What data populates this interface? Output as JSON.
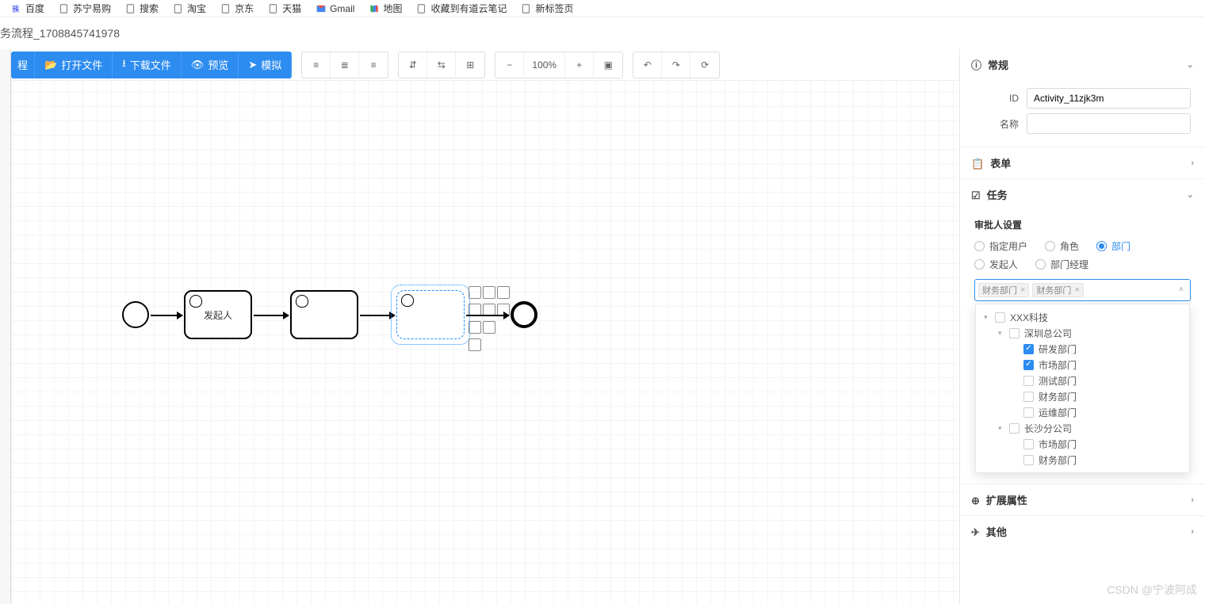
{
  "bookmarks": [
    {
      "label": "百度",
      "icon": "baidu"
    },
    {
      "label": "苏宁易购",
      "icon": "page"
    },
    {
      "label": "搜索",
      "icon": "page"
    },
    {
      "label": "淘宝",
      "icon": "page"
    },
    {
      "label": "京东",
      "icon": "page"
    },
    {
      "label": "天猫",
      "icon": "page"
    },
    {
      "label": "Gmail",
      "icon": "gmail"
    },
    {
      "label": "地图",
      "icon": "map"
    },
    {
      "label": "收藏到有道云笔记",
      "icon": "page"
    },
    {
      "label": "新标签页",
      "icon": "page"
    }
  ],
  "page_title": "务流程_1708845741978",
  "toolbar": {
    "process": "程",
    "open": "打开文件",
    "download": "下载文件",
    "preview": "预览",
    "simulate": "模拟",
    "zoom": "100%"
  },
  "nodes": {
    "task1": "发起人",
    "task2": "",
    "task3": ""
  },
  "panel": {
    "sections": {
      "general": "常规",
      "form": "表单",
      "task": "任务",
      "ext": "扩展属性",
      "other": "其他"
    },
    "fields": {
      "id_label": "ID",
      "id_value": "Activity_11zjk3m",
      "name_label": "名称",
      "name_value": ""
    },
    "approver": {
      "title": "审批人设置",
      "options": [
        "指定用户",
        "角色",
        "部门",
        "发起人",
        "部门经理"
      ],
      "selected": "部门",
      "tags": [
        "财务部门",
        "财务部门"
      ],
      "tree": [
        {
          "level": 0,
          "expanded": true,
          "checked": false,
          "label": "XXX科技"
        },
        {
          "level": 1,
          "expanded": true,
          "checked": false,
          "label": "深圳总公司"
        },
        {
          "level": 2,
          "expanded": false,
          "checked": true,
          "label": "研发部门"
        },
        {
          "level": 2,
          "expanded": false,
          "checked": true,
          "label": "市场部门"
        },
        {
          "level": 2,
          "expanded": false,
          "checked": false,
          "label": "测试部门"
        },
        {
          "level": 2,
          "expanded": false,
          "checked": false,
          "label": "财务部门"
        },
        {
          "level": 2,
          "expanded": false,
          "checked": false,
          "label": "运维部门"
        },
        {
          "level": 1,
          "expanded": true,
          "checked": false,
          "label": "长沙分公司"
        },
        {
          "level": 2,
          "expanded": false,
          "checked": false,
          "label": "市场部门"
        },
        {
          "level": 2,
          "expanded": false,
          "checked": false,
          "label": "财务部门"
        }
      ]
    }
  },
  "watermark": "CSDN @宁波阿成"
}
